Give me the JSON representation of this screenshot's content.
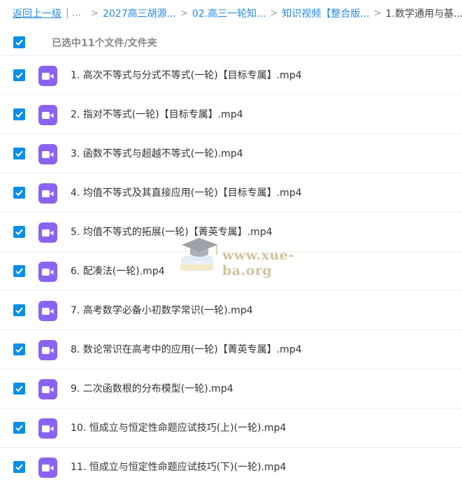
{
  "breadcrumb": {
    "back": "返回上一级",
    "separator_bar": "|",
    "ellipsis": "...",
    "items": [
      "2027高三胡源...",
      "02.高三一轮知...",
      "知识视频【整合版...",
      "1.数学通用与基..."
    ],
    "arrow": ">"
  },
  "selection": {
    "label": "已选中11个文件/文件夹",
    "checked": true
  },
  "files": [
    {
      "name": "1. 高次不等式与分式不等式(一轮)【目标专属】.mp4",
      "checked": true,
      "icon": "video-icon"
    },
    {
      "name": "2. 指对不等式(一轮)【目标专属】.mp4",
      "checked": true,
      "icon": "video-icon"
    },
    {
      "name": "3. 函数不等式与超越不等式(一轮).mp4",
      "checked": true,
      "icon": "video-icon"
    },
    {
      "name": "4. 均值不等式及其直接应用(一轮)【目标专属】.mp4",
      "checked": true,
      "icon": "video-icon"
    },
    {
      "name": "5. 均值不等式的拓展(一轮)【菁英专属】.mp4",
      "checked": true,
      "icon": "video-icon"
    },
    {
      "name": "6. 配凑法(一轮).mp4",
      "checked": true,
      "icon": "video-icon"
    },
    {
      "name": "7. 高考数学必备小初数学常识(一轮).mp4",
      "checked": true,
      "icon": "video-icon"
    },
    {
      "name": "8. 数论常识在高考中的应用(一轮)【菁英专属】.mp4",
      "checked": true,
      "icon": "video-icon"
    },
    {
      "name": "9. 二次函数根的分布模型(一轮).mp4",
      "checked": true,
      "icon": "video-icon"
    },
    {
      "name": "10. 恒成立与恒定性命题应试技巧(上)(一轮).mp4",
      "checked": true,
      "icon": "video-icon"
    },
    {
      "name": "11. 恒成立与恒定性命题应试技巧(下)(一轮).mp4",
      "checked": true,
      "icon": "video-icon"
    }
  ],
  "watermark": {
    "text": "www.xue-ba.org"
  },
  "colors": {
    "link": "#2589e6",
    "checkbox": "#0a8ee9",
    "video_icon": "#8a63f2",
    "row_divider": "#eef0f4"
  }
}
